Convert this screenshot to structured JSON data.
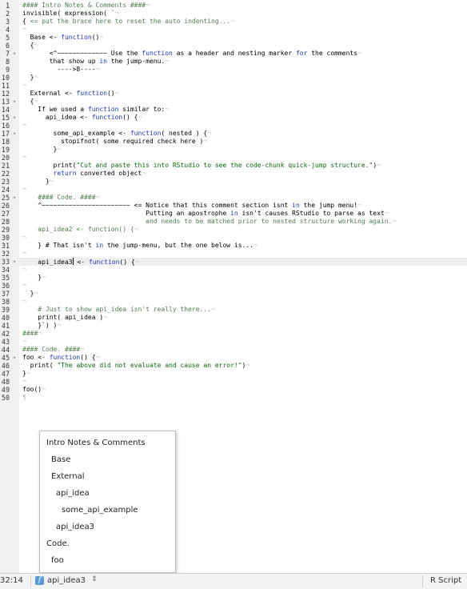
{
  "editor": {
    "lines": [
      {
        "num": "1",
        "fold": "",
        "segs": [
          [
            "comment",
            "#### Intro Notes & Comments ####"
          ],
          [
            "invisible",
            "¬"
          ]
        ]
      },
      {
        "num": "2",
        "fold": "",
        "segs": [
          [
            "plain",
            "invisible( expression( `"
          ],
          [
            "invisible",
            "¬"
          ]
        ]
      },
      {
        "num": "3",
        "fold": "",
        "segs": [
          [
            "plain",
            "{ "
          ],
          [
            "comment",
            "<= put the brace here to reset the auto indenting..."
          ],
          [
            "invisible",
            "¬"
          ]
        ]
      },
      {
        "num": "4",
        "fold": "",
        "segs": [
          [
            "invisible",
            "¬"
          ]
        ]
      },
      {
        "num": "5",
        "fold": "",
        "segs": [
          [
            "plain",
            "  Base <- "
          ],
          [
            "keyword",
            "function"
          ],
          [
            "plain",
            "()"
          ],
          [
            "invisible",
            "¬"
          ]
        ]
      },
      {
        "num": "6",
        "fold": "",
        "segs": [
          [
            "plain",
            "  {"
          ],
          [
            "invisible",
            "¬"
          ]
        ]
      },
      {
        "num": "7",
        "fold": "▾",
        "segs": [
          [
            "plain",
            "       <^~~~~~~~~~~~~~ Use the "
          ],
          [
            "keyword",
            "function"
          ],
          [
            "plain",
            " as a header and nesting marker "
          ],
          [
            "keyword",
            "for"
          ],
          [
            "plain",
            " the comments"
          ],
          [
            "invisible",
            "¬"
          ]
        ]
      },
      {
        "num": "8",
        "fold": "",
        "segs": [
          [
            "plain",
            "       that show up "
          ],
          [
            "keyword",
            "in"
          ],
          [
            "plain",
            " the jump-menu."
          ],
          [
            "invisible",
            "¬"
          ]
        ]
      },
      {
        "num": "9",
        "fold": "",
        "segs": [
          [
            "plain",
            "         ---->8----"
          ],
          [
            "invisible",
            "¬"
          ]
        ]
      },
      {
        "num": "10",
        "fold": "",
        "segs": [
          [
            "plain",
            "  }"
          ],
          [
            "invisible",
            "¬"
          ]
        ]
      },
      {
        "num": "11",
        "fold": "",
        "segs": [
          [
            "invisible",
            "¬"
          ]
        ]
      },
      {
        "num": "12",
        "fold": "",
        "segs": [
          [
            "plain",
            "  External <- "
          ],
          [
            "keyword",
            "function"
          ],
          [
            "plain",
            "()"
          ],
          [
            "invisible",
            "¬"
          ]
        ]
      },
      {
        "num": "13",
        "fold": "▾",
        "segs": [
          [
            "plain",
            "  {"
          ],
          [
            "invisible",
            "¬"
          ]
        ]
      },
      {
        "num": "14",
        "fold": "",
        "segs": [
          [
            "plain",
            "    If we used a "
          ],
          [
            "keyword",
            "function"
          ],
          [
            "plain",
            " similar to:"
          ],
          [
            "invisible",
            "¬"
          ]
        ]
      },
      {
        "num": "15",
        "fold": "▾",
        "segs": [
          [
            "plain",
            "      api_idea <- "
          ],
          [
            "keyword",
            "function"
          ],
          [
            "plain",
            "() {"
          ],
          [
            "invisible",
            "¬"
          ]
        ]
      },
      {
        "num": "16",
        "fold": "",
        "segs": [
          [
            "invisible",
            "¬"
          ]
        ]
      },
      {
        "num": "17",
        "fold": "▾",
        "segs": [
          [
            "plain",
            "        some_api_example <- "
          ],
          [
            "keyword",
            "function"
          ],
          [
            "plain",
            "( nested ) {"
          ],
          [
            "invisible",
            "¬"
          ]
        ]
      },
      {
        "num": "18",
        "fold": "",
        "segs": [
          [
            "plain",
            "          stopifnot( some required check here )"
          ],
          [
            "invisible",
            "¬"
          ]
        ]
      },
      {
        "num": "19",
        "fold": "",
        "segs": [
          [
            "plain",
            "        }"
          ],
          [
            "invisible",
            "¬"
          ]
        ]
      },
      {
        "num": "20",
        "fold": "",
        "segs": [
          [
            "invisible",
            "¬"
          ]
        ]
      },
      {
        "num": "21",
        "fold": "",
        "segs": [
          [
            "plain",
            "        print("
          ],
          [
            "string",
            "\"Cut and paste this into RStudio to see the code-chunk quick-jump structure.\""
          ],
          [
            "plain",
            ")"
          ],
          [
            "invisible",
            "¬"
          ]
        ]
      },
      {
        "num": "22",
        "fold": "",
        "segs": [
          [
            "plain",
            "        "
          ],
          [
            "keyword",
            "return"
          ],
          [
            "plain",
            " converted object"
          ],
          [
            "invisible",
            "¬"
          ]
        ]
      },
      {
        "num": "23",
        "fold": "",
        "segs": [
          [
            "plain",
            "      }"
          ],
          [
            "invisible",
            "¬"
          ]
        ]
      },
      {
        "num": "24",
        "fold": "",
        "segs": [
          [
            "invisible",
            "¬"
          ]
        ]
      },
      {
        "num": "25",
        "fold": "▾",
        "segs": [
          [
            "plain",
            "    "
          ],
          [
            "comment",
            "#### Code. ####"
          ],
          [
            "invisible",
            "¬"
          ]
        ]
      },
      {
        "num": "26",
        "fold": "",
        "segs": [
          [
            "plain",
            "    ^~~~~~~~~~~~~~~~~~~~~~~~ <= Notice that this comment section isnt "
          ],
          [
            "keyword",
            "in"
          ],
          [
            "plain",
            " the jump menu!"
          ],
          [
            "invisible",
            "¬"
          ]
        ]
      },
      {
        "num": "27",
        "fold": "",
        "segs": [
          [
            "plain",
            "                                Putting an apostrophe "
          ],
          [
            "keyword",
            "in"
          ],
          [
            "plain",
            " isn't causes RStudio to parse as text"
          ],
          [
            "invisible",
            "¬"
          ]
        ]
      },
      {
        "num": "28",
        "fold": "",
        "segs": [
          [
            "plain",
            "                                "
          ],
          [
            "comment",
            "and needs to be matched prior to nested structure working again."
          ],
          [
            "invisible",
            "¬"
          ]
        ]
      },
      {
        "num": "29",
        "fold": "",
        "segs": [
          [
            "plain",
            "    "
          ],
          [
            "comment",
            "api_idea2 <- function() {"
          ],
          [
            "invisible",
            "¬"
          ]
        ]
      },
      {
        "num": "30",
        "fold": "",
        "segs": [
          [
            "invisible",
            "¬"
          ]
        ]
      },
      {
        "num": "31",
        "fold": "",
        "segs": [
          [
            "plain",
            "    } # That isn't "
          ],
          [
            "keyword",
            "in"
          ],
          [
            "plain",
            " the jump-menu, but the one below is..."
          ],
          [
            "invisible",
            "¬"
          ]
        ]
      },
      {
        "num": "32",
        "fold": "",
        "segs": [
          [
            "invisible",
            "¬"
          ]
        ]
      },
      {
        "num": "33",
        "fold": "▾",
        "segs": [
          [
            "plain",
            "    api_idea3"
          ],
          [
            "cursor",
            ""
          ],
          [
            "plain",
            " <- "
          ],
          [
            "keyword",
            "function"
          ],
          [
            "plain",
            "() {"
          ],
          [
            "invisible",
            "¬"
          ]
        ]
      },
      {
        "num": "34",
        "fold": "",
        "segs": [
          [
            "invisible",
            "¬"
          ]
        ]
      },
      {
        "num": "35",
        "fold": "",
        "segs": [
          [
            "plain",
            "    }"
          ],
          [
            "invisible",
            "¬"
          ]
        ]
      },
      {
        "num": "36",
        "fold": "",
        "segs": [
          [
            "invisible",
            "¬"
          ]
        ]
      },
      {
        "num": "37",
        "fold": "",
        "segs": [
          [
            "plain",
            "  }"
          ],
          [
            "invisible",
            "¬"
          ]
        ]
      },
      {
        "num": "38",
        "fold": "",
        "segs": [
          [
            "invisible",
            "¬"
          ]
        ]
      },
      {
        "num": "39",
        "fold": "",
        "segs": [
          [
            "plain",
            "    "
          ],
          [
            "comment",
            "# Just to show api_idea isn't really there..."
          ],
          [
            "invisible",
            "¬"
          ]
        ]
      },
      {
        "num": "40",
        "fold": "",
        "segs": [
          [
            "plain",
            "    print( api_idea )"
          ],
          [
            "invisible",
            "¬"
          ]
        ]
      },
      {
        "num": "41",
        "fold": "",
        "segs": [
          [
            "plain",
            "    }`) )"
          ],
          [
            "invisible",
            "¬"
          ]
        ]
      },
      {
        "num": "42",
        "fold": "",
        "segs": [
          [
            "comment",
            "####"
          ],
          [
            "invisible",
            "¬"
          ]
        ]
      },
      {
        "num": "43",
        "fold": "",
        "segs": [
          [
            "invisible",
            "¬"
          ]
        ]
      },
      {
        "num": "44",
        "fold": "",
        "segs": [
          [
            "comment",
            "#### Code. ####"
          ],
          [
            "invisible",
            "¬"
          ]
        ]
      },
      {
        "num": "45",
        "fold": "▾",
        "segs": [
          [
            "plain",
            "foo <- "
          ],
          [
            "keyword",
            "function"
          ],
          [
            "plain",
            "() {"
          ],
          [
            "invisible",
            "¬"
          ]
        ]
      },
      {
        "num": "46",
        "fold": "",
        "segs": [
          [
            "plain",
            "  print( "
          ],
          [
            "string",
            "\"The above did not evaluate and cause an error!\""
          ],
          [
            "plain",
            ")"
          ],
          [
            "invisible",
            "¬"
          ]
        ]
      },
      {
        "num": "47",
        "fold": "",
        "segs": [
          [
            "plain",
            "}"
          ],
          [
            "invisible",
            "¬"
          ]
        ]
      },
      {
        "num": "48",
        "fold": "",
        "segs": [
          [
            "invisible",
            "¬"
          ]
        ]
      },
      {
        "num": "49",
        "fold": "",
        "segs": [
          [
            "plain",
            "foo()"
          ],
          [
            "invisible",
            "¬"
          ]
        ]
      },
      {
        "num": "50",
        "fold": "",
        "segs": [
          [
            "invisible",
            "¶"
          ]
        ]
      }
    ],
    "active_line": "33"
  },
  "jump_menu": {
    "items": [
      {
        "label": "Intro Notes & Comments",
        "level": 0
      },
      {
        "label": "Base",
        "level": 1
      },
      {
        "label": "External",
        "level": 1
      },
      {
        "label": "api_idea",
        "level": 2
      },
      {
        "label": "some_api_example",
        "level": 3
      },
      {
        "label": "api_idea3",
        "level": 2
      },
      {
        "label": "Code.",
        "level": 0
      },
      {
        "label": "foo",
        "level": 1
      }
    ]
  },
  "statusbar": {
    "position": "32:14",
    "function_icon": "f",
    "function_label": "api_idea3",
    "language": "R Script"
  },
  "colors": {
    "comment": "#4d7f4d",
    "keyword": "#1a35c6",
    "string": "#0a6b0a"
  }
}
